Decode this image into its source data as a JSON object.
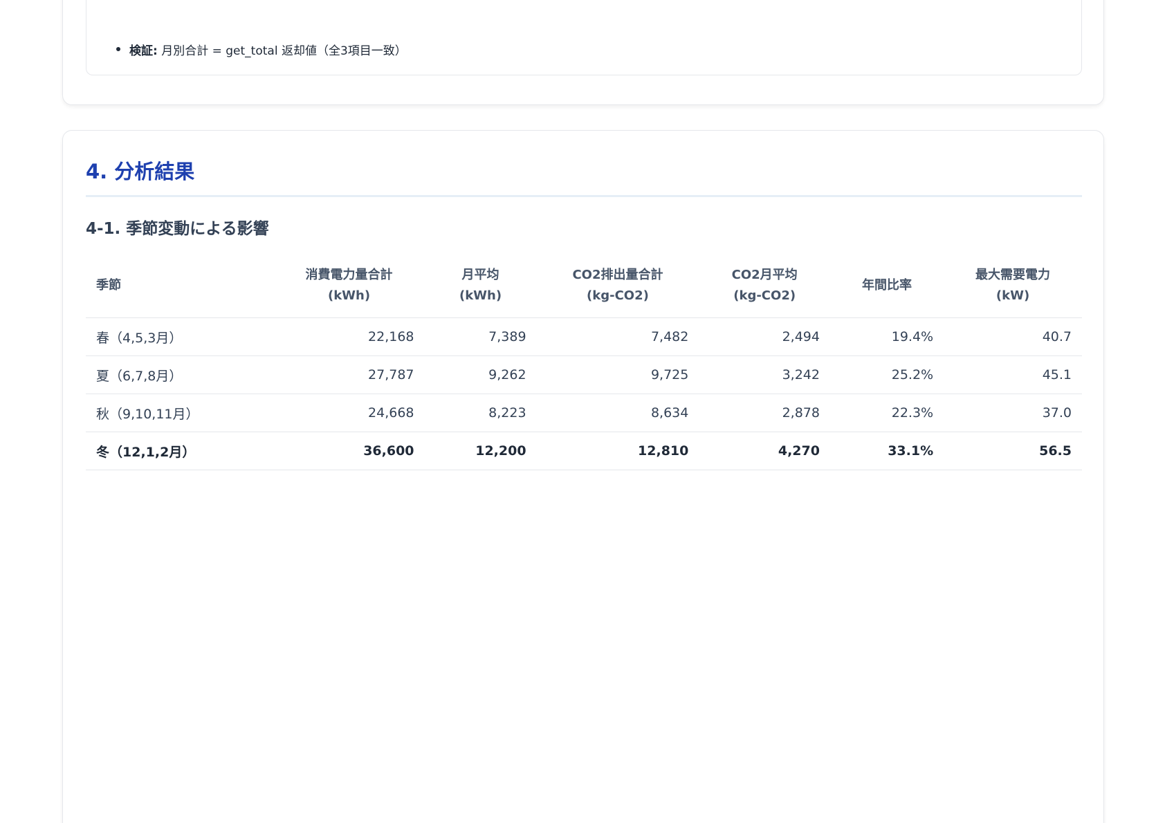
{
  "prev_section": {
    "note_label": "検証:",
    "note_text": "月別合計 = get_total 返却値（全3項目一致）"
  },
  "section": {
    "title": "4. 分析結果",
    "subsection_title": "4-1. 季節変動による影響"
  },
  "table": {
    "headers": [
      {
        "line1": "季節",
        "line2": ""
      },
      {
        "line1": "消費電力量合計",
        "line2": "(kWh)"
      },
      {
        "line1": "月平均",
        "line2": "(kWh)"
      },
      {
        "line1": "CO2排出量合計",
        "line2": "(kg-CO2)"
      },
      {
        "line1": "CO2月平均",
        "line2": "(kg-CO2)"
      },
      {
        "line1": "年間比率",
        "line2": ""
      },
      {
        "line1": "最大需要電力",
        "line2": "(kW)"
      }
    ],
    "rows": [
      [
        "春（4,5,3月）",
        "22,168",
        "7,389",
        "7,482",
        "2,494",
        "19.4%",
        "40.7"
      ],
      [
        "夏（6,7,8月）",
        "27,787",
        "9,262",
        "9,725",
        "3,242",
        "25.2%",
        "45.1"
      ],
      [
        "秋（9,10,11月）",
        "24,668",
        "8,223",
        "8,634",
        "2,878",
        "22.3%",
        "37.0"
      ],
      [
        "冬（12,1,2月）",
        "36,600",
        "12,200",
        "12,810",
        "4,270",
        "33.1%",
        "56.5"
      ]
    ],
    "highlight_row": 3
  }
}
